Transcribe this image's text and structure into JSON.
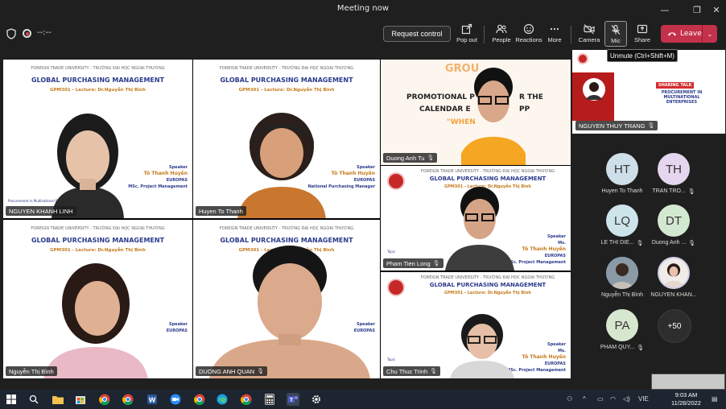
{
  "window": {
    "title": "Meeting now",
    "controls": [
      "minimize",
      "restore",
      "close"
    ]
  },
  "toolbar": {
    "timer": "--:--",
    "request_control": "Request control",
    "pop_out": "Pop out",
    "people": "People",
    "reactions": "Reactions",
    "more": "More",
    "camera": "Camera",
    "mic": "Mic",
    "share": "Share",
    "leave": "Leave"
  },
  "tooltip": "Unmute (Ctrl+Shift+M)",
  "slide": {
    "university": "FOREIGN TRADE UNIVERSITY - TRƯỜNG ĐẠI HỌC NGOẠI THƯƠNG",
    "course": "GLOBAL PURCHASING MANAGEMENT",
    "lecture": "GPM301 - Lecture: Dr.Nguyễn Thị Bình",
    "speaker_label": "Speaker",
    "speaker_title": "Ms.",
    "speaker_name": "Tô Thanh Huyền",
    "speaker_org": "EUROPAS",
    "speaker_role": "MSc. Project Management",
    "speaker_role2": "National Purchasing Manager",
    "topic_label": "Topic",
    "topic_text": "Procurement in Multinational Enterprises",
    "group_word": "GROU",
    "promo_line1": "PROMOTIONAL P",
    "promo_line1b": "R THE",
    "promo_line2": "CALENDAR E",
    "promo_line2b": "PP",
    "promo_line3": "\"WHEN"
  },
  "tiles": [
    {
      "name": "NGUYEN KHANH LINH",
      "mic": false
    },
    {
      "name": "Huyen To Thanh",
      "mic": false
    },
    {
      "name": "Duong Anh Tu",
      "mic": true
    },
    {
      "name": "Pham Tien Long",
      "mic": true
    },
    {
      "name": "Nguyễn Thị Bình",
      "mic": false
    },
    {
      "name": "DUONG ANH QUAN",
      "mic": true
    },
    {
      "name": "Chu Thuc Trinh",
      "mic": true
    }
  ],
  "share_tile": {
    "name": "NGUYEN THUY TRANG",
    "mic": true,
    "talk": "SHARING TALK",
    "procurement": "PROCUREMENT IN MULTINATIONAL ENTERPRISES"
  },
  "participants": [
    {
      "initials": "HT",
      "name": "Huyen To Thanh",
      "color": "#cfdfe9",
      "mic": false
    },
    {
      "initials": "TH",
      "name": "TRAN TRO...",
      "color": "#e3d6ee",
      "mic": true
    },
    {
      "initials": "LQ",
      "name": "LE THI DIE...",
      "color": "#cde4ea",
      "mic": true
    },
    {
      "initials": "DT",
      "name": "Duong Anh ...",
      "color": "#d3e8d0",
      "mic": true
    },
    {
      "initials": "",
      "name": "Nguyễn Thị Bình",
      "color": "#9aa7b1",
      "mic": false
    },
    {
      "initials": "",
      "name": "NGUYEN KHAN...",
      "color": "#d7c6c0",
      "mic": false
    },
    {
      "initials": "PA",
      "name": "PHAM QUY...",
      "color": "#d7e6cf",
      "mic": true
    }
  ],
  "more_count": "+50",
  "taskbar": {
    "lang": "VIE",
    "time": "9:03 AM",
    "date": "11/28/2022"
  }
}
